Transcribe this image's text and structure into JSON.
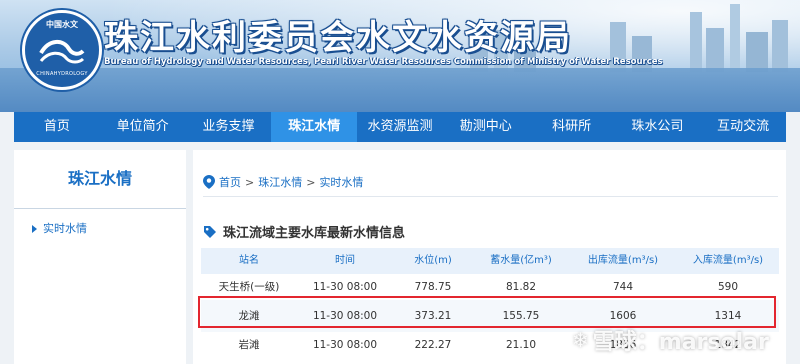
{
  "header": {
    "logo_top_text": "中国水文",
    "logo_bottom_text": "CHINAHYDROLOGY",
    "title_cn": "珠江水利委员会水文水资源局",
    "title_en": "Bureau of Hydrology and Water Resources, Pearl River Water Resources Commission of Ministry of Water Resources"
  },
  "nav": {
    "items": [
      "首页",
      "单位简介",
      "业务支撑",
      "珠江水情",
      "水资源监测",
      "勘测中心",
      "科研所",
      "珠水公司",
      "互动交流"
    ],
    "active_index": 3
  },
  "sidebar": {
    "title": "珠江水情",
    "items": [
      "实时水情"
    ]
  },
  "breadcrumb": {
    "items": [
      "首页",
      "珠江水情",
      "实时水情"
    ],
    "separator": ">"
  },
  "section": {
    "title": "珠江流域主要水库最新水情信息"
  },
  "table": {
    "headers": [
      "站名",
      "时间",
      "水位(m)",
      "蓄水量(亿m³)",
      "出库流量(m³/s)",
      "入库流量(m³/s)"
    ],
    "rows": [
      [
        "天生桥(一级)",
        "11-30 08:00",
        "778.75",
        "81.82",
        "744",
        "590"
      ],
      [
        "龙滩",
        "11-30 08:00",
        "373.21",
        "155.75",
        "1606",
        "1314"
      ],
      [
        "岩滩",
        "11-30 08:00",
        "222.27",
        "21.10",
        "1836",
        "1842"
      ]
    ],
    "highlight_row": 1
  },
  "watermark": {
    "text": "雪球：marsolar"
  },
  "colors": {
    "nav": "#1a6fc4",
    "nav_active": "#2f92e6",
    "highlight": "#e3262f",
    "link": "#1a6fc4"
  }
}
